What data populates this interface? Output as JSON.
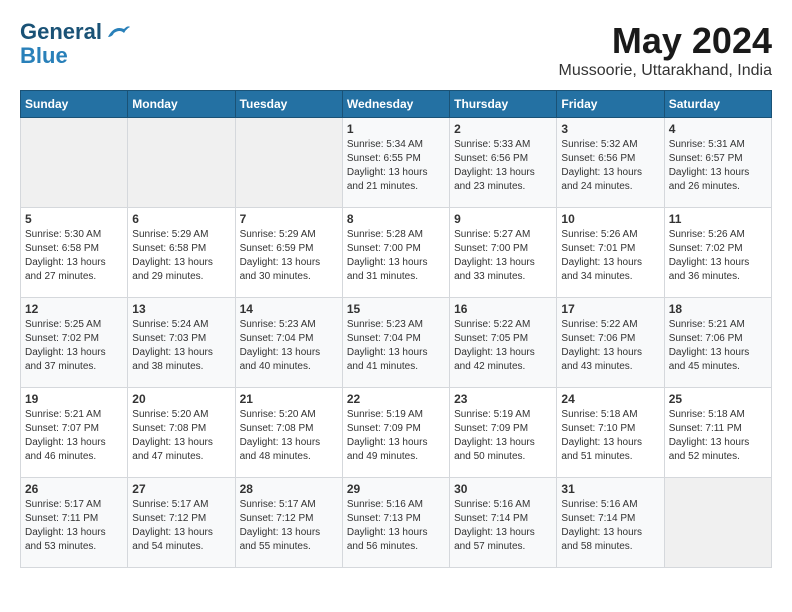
{
  "header": {
    "logo_line1": "General",
    "logo_line2": "Blue",
    "month_title": "May 2024",
    "location": "Mussoorie, Uttarakhand, India"
  },
  "weekdays": [
    "Sunday",
    "Monday",
    "Tuesday",
    "Wednesday",
    "Thursday",
    "Friday",
    "Saturday"
  ],
  "weeks": [
    [
      {
        "day": "",
        "sunrise": "",
        "sunset": "",
        "daylight": ""
      },
      {
        "day": "",
        "sunrise": "",
        "sunset": "",
        "daylight": ""
      },
      {
        "day": "",
        "sunrise": "",
        "sunset": "",
        "daylight": ""
      },
      {
        "day": "1",
        "sunrise": "Sunrise: 5:34 AM",
        "sunset": "Sunset: 6:55 PM",
        "daylight": "Daylight: 13 hours and 21 minutes."
      },
      {
        "day": "2",
        "sunrise": "Sunrise: 5:33 AM",
        "sunset": "Sunset: 6:56 PM",
        "daylight": "Daylight: 13 hours and 23 minutes."
      },
      {
        "day": "3",
        "sunrise": "Sunrise: 5:32 AM",
        "sunset": "Sunset: 6:56 PM",
        "daylight": "Daylight: 13 hours and 24 minutes."
      },
      {
        "day": "4",
        "sunrise": "Sunrise: 5:31 AM",
        "sunset": "Sunset: 6:57 PM",
        "daylight": "Daylight: 13 hours and 26 minutes."
      }
    ],
    [
      {
        "day": "5",
        "sunrise": "Sunrise: 5:30 AM",
        "sunset": "Sunset: 6:58 PM",
        "daylight": "Daylight: 13 hours and 27 minutes."
      },
      {
        "day": "6",
        "sunrise": "Sunrise: 5:29 AM",
        "sunset": "Sunset: 6:58 PM",
        "daylight": "Daylight: 13 hours and 29 minutes."
      },
      {
        "day": "7",
        "sunrise": "Sunrise: 5:29 AM",
        "sunset": "Sunset: 6:59 PM",
        "daylight": "Daylight: 13 hours and 30 minutes."
      },
      {
        "day": "8",
        "sunrise": "Sunrise: 5:28 AM",
        "sunset": "Sunset: 7:00 PM",
        "daylight": "Daylight: 13 hours and 31 minutes."
      },
      {
        "day": "9",
        "sunrise": "Sunrise: 5:27 AM",
        "sunset": "Sunset: 7:00 PM",
        "daylight": "Daylight: 13 hours and 33 minutes."
      },
      {
        "day": "10",
        "sunrise": "Sunrise: 5:26 AM",
        "sunset": "Sunset: 7:01 PM",
        "daylight": "Daylight: 13 hours and 34 minutes."
      },
      {
        "day": "11",
        "sunrise": "Sunrise: 5:26 AM",
        "sunset": "Sunset: 7:02 PM",
        "daylight": "Daylight: 13 hours and 36 minutes."
      }
    ],
    [
      {
        "day": "12",
        "sunrise": "Sunrise: 5:25 AM",
        "sunset": "Sunset: 7:02 PM",
        "daylight": "Daylight: 13 hours and 37 minutes."
      },
      {
        "day": "13",
        "sunrise": "Sunrise: 5:24 AM",
        "sunset": "Sunset: 7:03 PM",
        "daylight": "Daylight: 13 hours and 38 minutes."
      },
      {
        "day": "14",
        "sunrise": "Sunrise: 5:23 AM",
        "sunset": "Sunset: 7:04 PM",
        "daylight": "Daylight: 13 hours and 40 minutes."
      },
      {
        "day": "15",
        "sunrise": "Sunrise: 5:23 AM",
        "sunset": "Sunset: 7:04 PM",
        "daylight": "Daylight: 13 hours and 41 minutes."
      },
      {
        "day": "16",
        "sunrise": "Sunrise: 5:22 AM",
        "sunset": "Sunset: 7:05 PM",
        "daylight": "Daylight: 13 hours and 42 minutes."
      },
      {
        "day": "17",
        "sunrise": "Sunrise: 5:22 AM",
        "sunset": "Sunset: 7:06 PM",
        "daylight": "Daylight: 13 hours and 43 minutes."
      },
      {
        "day": "18",
        "sunrise": "Sunrise: 5:21 AM",
        "sunset": "Sunset: 7:06 PM",
        "daylight": "Daylight: 13 hours and 45 minutes."
      }
    ],
    [
      {
        "day": "19",
        "sunrise": "Sunrise: 5:21 AM",
        "sunset": "Sunset: 7:07 PM",
        "daylight": "Daylight: 13 hours and 46 minutes."
      },
      {
        "day": "20",
        "sunrise": "Sunrise: 5:20 AM",
        "sunset": "Sunset: 7:08 PM",
        "daylight": "Daylight: 13 hours and 47 minutes."
      },
      {
        "day": "21",
        "sunrise": "Sunrise: 5:20 AM",
        "sunset": "Sunset: 7:08 PM",
        "daylight": "Daylight: 13 hours and 48 minutes."
      },
      {
        "day": "22",
        "sunrise": "Sunrise: 5:19 AM",
        "sunset": "Sunset: 7:09 PM",
        "daylight": "Daylight: 13 hours and 49 minutes."
      },
      {
        "day": "23",
        "sunrise": "Sunrise: 5:19 AM",
        "sunset": "Sunset: 7:09 PM",
        "daylight": "Daylight: 13 hours and 50 minutes."
      },
      {
        "day": "24",
        "sunrise": "Sunrise: 5:18 AM",
        "sunset": "Sunset: 7:10 PM",
        "daylight": "Daylight: 13 hours and 51 minutes."
      },
      {
        "day": "25",
        "sunrise": "Sunrise: 5:18 AM",
        "sunset": "Sunset: 7:11 PM",
        "daylight": "Daylight: 13 hours and 52 minutes."
      }
    ],
    [
      {
        "day": "26",
        "sunrise": "Sunrise: 5:17 AM",
        "sunset": "Sunset: 7:11 PM",
        "daylight": "Daylight: 13 hours and 53 minutes."
      },
      {
        "day": "27",
        "sunrise": "Sunrise: 5:17 AM",
        "sunset": "Sunset: 7:12 PM",
        "daylight": "Daylight: 13 hours and 54 minutes."
      },
      {
        "day": "28",
        "sunrise": "Sunrise: 5:17 AM",
        "sunset": "Sunset: 7:12 PM",
        "daylight": "Daylight: 13 hours and 55 minutes."
      },
      {
        "day": "29",
        "sunrise": "Sunrise: 5:16 AM",
        "sunset": "Sunset: 7:13 PM",
        "daylight": "Daylight: 13 hours and 56 minutes."
      },
      {
        "day": "30",
        "sunrise": "Sunrise: 5:16 AM",
        "sunset": "Sunset: 7:14 PM",
        "daylight": "Daylight: 13 hours and 57 minutes."
      },
      {
        "day": "31",
        "sunrise": "Sunrise: 5:16 AM",
        "sunset": "Sunset: 7:14 PM",
        "daylight": "Daylight: 13 hours and 58 minutes."
      },
      {
        "day": "",
        "sunrise": "",
        "sunset": "",
        "daylight": ""
      }
    ]
  ]
}
